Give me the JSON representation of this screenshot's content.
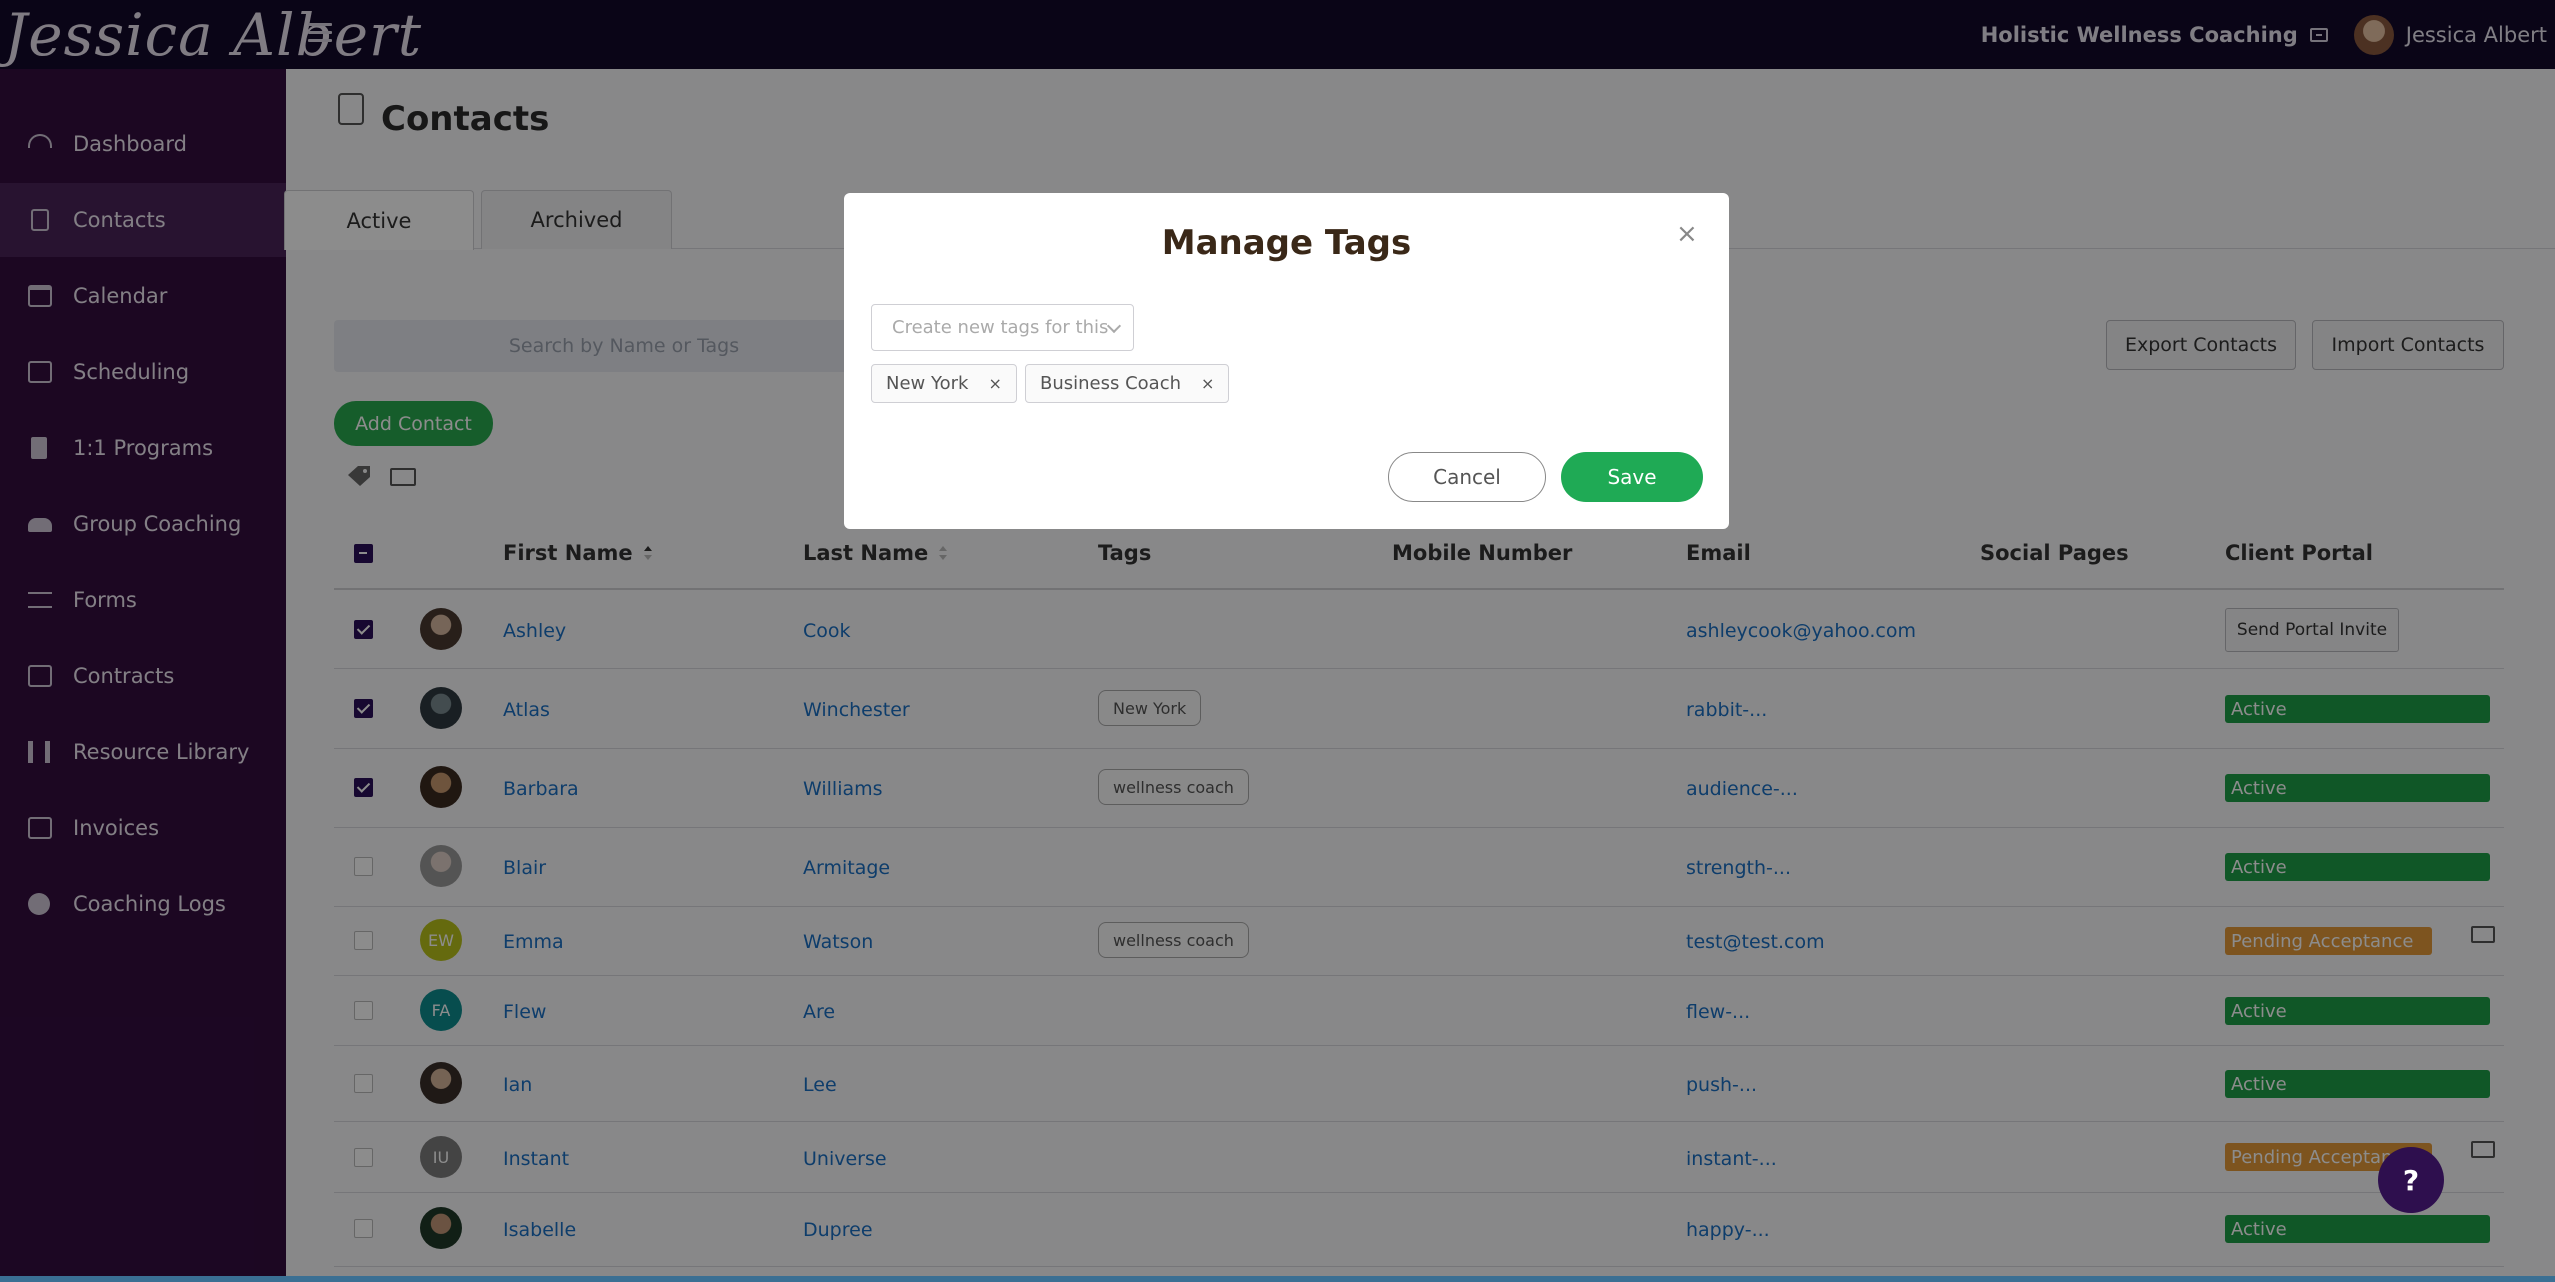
{
  "header": {
    "logo_text": "Jessica Albert",
    "business_name": "Holistic Wellness Coaching",
    "user_name": "Jessica Albert"
  },
  "sidebar": {
    "items": [
      {
        "label": "Dashboard",
        "icon": "dashboard-icon"
      },
      {
        "label": "Contacts",
        "icon": "contacts-icon",
        "active": true
      },
      {
        "label": "Calendar",
        "icon": "calendar-icon"
      },
      {
        "label": "Scheduling",
        "icon": "scheduling-icon"
      },
      {
        "label": "1:1 Programs",
        "icon": "book-icon"
      },
      {
        "label": "Group Coaching",
        "icon": "group-icon"
      },
      {
        "label": "Forms",
        "icon": "checklist-icon"
      },
      {
        "label": "Contracts",
        "icon": "signature-icon"
      },
      {
        "label": "Resource Library",
        "icon": "library-icon"
      },
      {
        "label": "Invoices",
        "icon": "invoice-icon"
      },
      {
        "label": "Coaching Logs",
        "icon": "clock-icon"
      }
    ]
  },
  "page": {
    "title": "Contacts",
    "tabs": [
      "Active",
      "Archived"
    ],
    "active_tab": "Active",
    "search_placeholder": "Search by Name or Tags",
    "export_label": "Export Contacts",
    "import_label": "Import Contacts",
    "add_contact_label": "Add Contact"
  },
  "table": {
    "headers": [
      "First Name",
      "Last Name",
      "Tags",
      "Mobile Number",
      "Email",
      "Social Pages",
      "Client Portal"
    ],
    "rows": [
      {
        "first": "Ashley",
        "last": "Cook",
        "tag": "",
        "email": "ashleycook@yahoo.com",
        "portal": "Send Portal Invite",
        "portal_type": "button",
        "checked": true,
        "initials": ""
      },
      {
        "first": "Atlas",
        "last": "Winchester",
        "tag": "New York",
        "email": "rabbit-...",
        "portal": "Active",
        "portal_type": "active",
        "checked": true,
        "initials": ""
      },
      {
        "first": "Barbara",
        "last": "Williams",
        "tag": "wellness coach",
        "email": "audience-...",
        "portal": "Active",
        "portal_type": "active",
        "checked": true,
        "initials": ""
      },
      {
        "first": "Blair",
        "last": "Armitage",
        "tag": "",
        "email": "strength-...",
        "portal": "Active",
        "portal_type": "active",
        "checked": false,
        "initials": ""
      },
      {
        "first": "Emma",
        "last": "Watson",
        "tag": "wellness coach",
        "email": "test@test.com",
        "portal": "Pending Acceptance",
        "portal_type": "pending",
        "checked": false,
        "initials": "EW"
      },
      {
        "first": "Flew",
        "last": "Are",
        "tag": "",
        "email": "flew-...",
        "portal": "Active",
        "portal_type": "active",
        "checked": false,
        "initials": "FA"
      },
      {
        "first": "Ian",
        "last": "Lee",
        "tag": "",
        "email": "push-...",
        "portal": "Active",
        "portal_type": "active",
        "checked": false,
        "initials": ""
      },
      {
        "first": "Instant",
        "last": "Universe",
        "tag": "",
        "email": "instant-...",
        "portal": "Pending Acceptance",
        "portal_type": "pending",
        "checked": false,
        "initials": "IU"
      },
      {
        "first": "Isabelle",
        "last": "Dupree",
        "tag": "",
        "email": "happy-...",
        "portal": "Active",
        "portal_type": "active",
        "checked": false,
        "initials": ""
      }
    ]
  },
  "modal": {
    "title": "Manage Tags",
    "close": "×",
    "select_placeholder": "Create new tags for this",
    "chips": [
      "New York",
      "Business Coach"
    ],
    "chip_remove": "×",
    "cancel_label": "Cancel",
    "save_label": "Save"
  },
  "help": {
    "label": "?"
  },
  "colors": {
    "topbar": "#130a2b",
    "sidebar": "#330d3f",
    "active_green": "#1e9e48",
    "pending_orange": "#e39a3a",
    "link_blue": "#1a6fc4",
    "save_green": "#1faa55"
  }
}
